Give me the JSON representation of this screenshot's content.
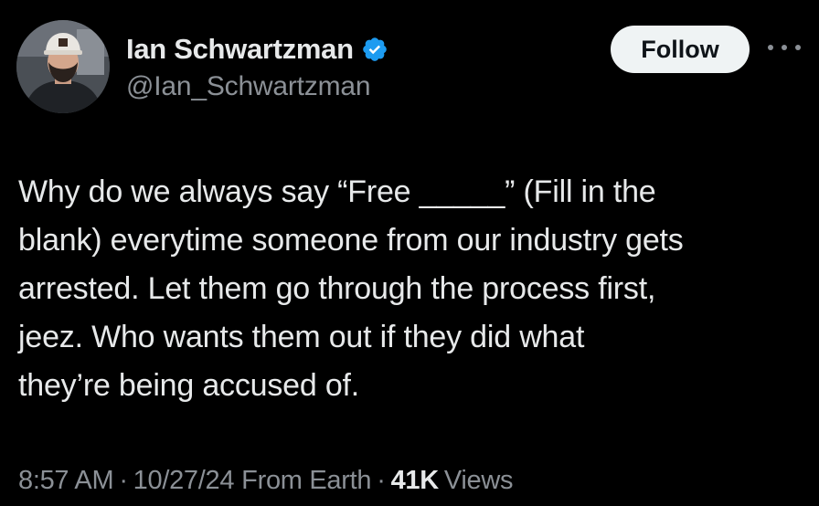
{
  "author": {
    "display_name": "Ian Schwartzman",
    "handle": "@Ian_Schwartzman",
    "verified": true,
    "avatar_icon": "user-avatar-photo"
  },
  "actions": {
    "follow_label": "Follow",
    "more_icon": "more-horizontal-icon"
  },
  "tweet": {
    "lines": [
      "Why do we always say “Free _____” (Fill in the",
      "blank) everytime someone from our industry gets",
      "arrested. Let them go through the process first,",
      "jeez. Who wants them out if they did what",
      "they’re being accused of."
    ]
  },
  "meta": {
    "time": "8:57 AM",
    "separator": "·",
    "date": "10/27/24",
    "location": "From Earth",
    "views_count": "41K",
    "views_label": "Views"
  },
  "colors": {
    "background": "#000000",
    "text_primary": "#e7e9ea",
    "text_secondary": "#8b9096",
    "verified_blue": "#1d9bf0",
    "follow_bg": "#eff3f4"
  }
}
